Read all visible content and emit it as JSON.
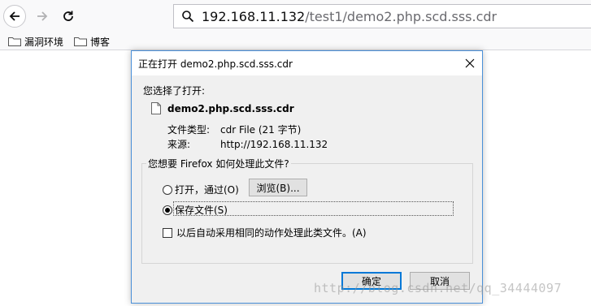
{
  "browser": {
    "url_host": "192.168.11.132",
    "url_path": "/test1/demo2.php.scd.sss.cdr",
    "bookmarks": [
      {
        "label": "漏洞环境",
        "icon": "folder-icon"
      },
      {
        "label": "博客",
        "icon": "folder-icon"
      }
    ]
  },
  "dialog": {
    "title": "正在打开 demo2.php.scd.sss.cdr",
    "prompt": "您选择了打开:",
    "file_name": "demo2.php.scd.sss.cdr",
    "file_type_label": "文件类型:",
    "file_type_value": "cdr File (21 字节)",
    "source_label": "来源:",
    "source_value": "http://192.168.11.132",
    "group_label": "您想要 Firefox 如何处理此文件?",
    "open_with_label": "打开，通过(O)",
    "browse_label": "浏览(B)...",
    "save_file_label": "保存文件(S)",
    "remember_label": "以后自动采用相同的动作处理此类文件。(A)",
    "ok_label": "确定",
    "cancel_label": "取消",
    "selected_option": "save_file",
    "remember_checked": false
  },
  "watermark": "http://blog.csdn.net/qq_34444097",
  "colors": {
    "accent": "#0078d7",
    "dialog_border": "#4a90d9",
    "dialog_bg": "#f0f0f0"
  }
}
